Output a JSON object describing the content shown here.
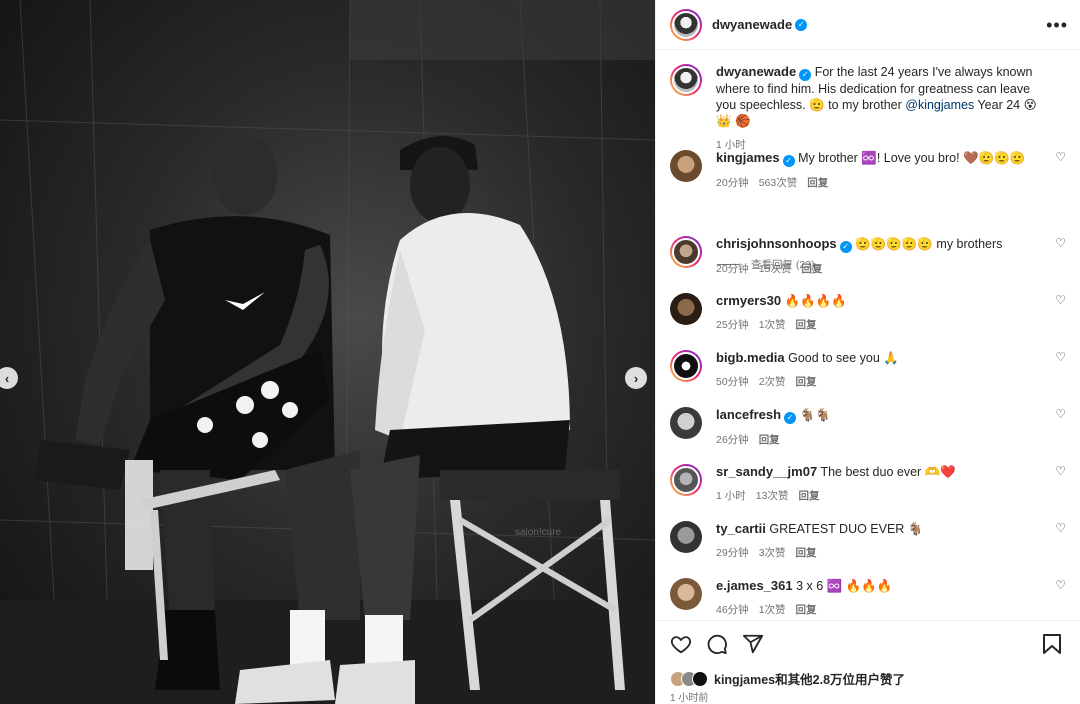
{
  "post": {
    "author": "dwyanewade",
    "more_label": "•••"
  },
  "caption": {
    "username": "dwyanewade",
    "text_1": "For the last 24 years I've always known where to find him. His dedication for greatness can leave you speechless. ",
    "text_2": "🫡 to my brother ",
    "mention": "@kingjames",
    "text_3": " Year 24 😵 👑 🏀",
    "time": "1 小时"
  },
  "comments": [
    {
      "username": "kingjames",
      "verified": true,
      "text": "My brother ♾️! Love you bro! 🤎🫡🫡🫡",
      "time": "20分钟",
      "likes": "563次赞",
      "reply": "回复"
    },
    {
      "username": "chrisjohnsonhoops",
      "verified": true,
      "text": "🫡🫡🫡🫡🫡 my brothers",
      "time": "20分钟",
      "likes": "15次赞",
      "reply": "回复"
    },
    {
      "username": "crmyers30",
      "verified": false,
      "text": "🔥🔥🔥🔥",
      "time": "25分钟",
      "likes": "1次赞",
      "reply": "回复"
    },
    {
      "username": "bigb.media",
      "verified": false,
      "text": "Good to see you 🙏",
      "time": "50分钟",
      "likes": "2次赞",
      "reply": "回复"
    },
    {
      "username": "lancefresh",
      "verified": true,
      "text": "🐐🐐",
      "time": "26分钟",
      "likes": "",
      "reply": "回复"
    },
    {
      "username": "sr_sandy__jm07",
      "verified": false,
      "text": "The best duo ever 🫶❤️",
      "time": "1 小时",
      "likes": "13次赞",
      "reply": "回复"
    },
    {
      "username": "ty_cartii",
      "verified": false,
      "text": "GREATEST DUO EVER 🐐",
      "time": "29分钟",
      "likes": "3次赞",
      "reply": "回复"
    },
    {
      "username": "e.james_361",
      "verified": false,
      "text": "3 x 6 ♾️ 🔥🔥🔥",
      "time": "46分钟",
      "likes": "1次赞",
      "reply": "回复"
    }
  ],
  "view_replies": "查看回复 (23)",
  "likes_summary": {
    "text": "kingjames和其他2.8万位用户赞了"
  },
  "post_time": "1 小时前",
  "photo": {
    "box_brand": "salon!cure"
  },
  "colors": {
    "link": "#00376b",
    "verified": "#0095f6",
    "muted": "#737373"
  }
}
